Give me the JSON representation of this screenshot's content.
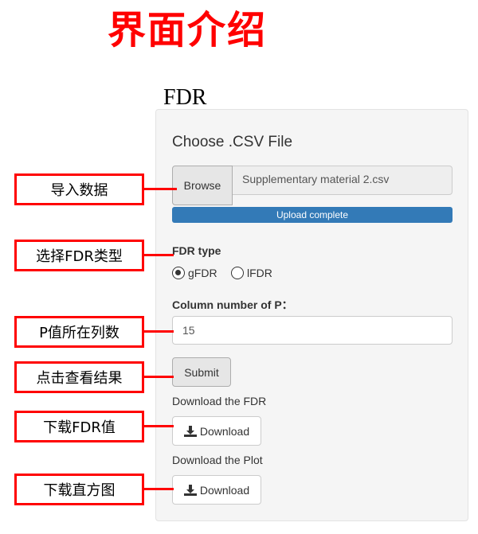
{
  "headline": "界面介绍",
  "app_title": "FDR",
  "panel": {
    "file_section_title": "Choose .CSV File",
    "browse_label": "Browse",
    "file_name": "Supplementary material 2.csv",
    "upload_status": "Upload complete",
    "fdr_type_label": "FDR type",
    "fdr_options": [
      {
        "label": "gFDR",
        "selected": true
      },
      {
        "label": "lFDR",
        "selected": false
      }
    ],
    "column_label": "Column number of P：",
    "column_value": "15",
    "submit_label": "Submit",
    "download_fdr_label": "Download the FDR",
    "download_plot_label": "Download the Plot",
    "download_button_label": "Download"
  },
  "annotations": {
    "import_data": "导入数据",
    "select_fdr_type": "选择FDR类型",
    "p_value_column": "P值所在列数",
    "view_results": "点击查看结果",
    "download_fdr_value": "下载FDR值",
    "download_histogram": "下载直方图"
  },
  "colors": {
    "annotation_red": "#ff0000",
    "progress_blue": "#337ab7",
    "panel_bg": "#f5f5f5"
  },
  "icons": {
    "download": "download-icon"
  }
}
